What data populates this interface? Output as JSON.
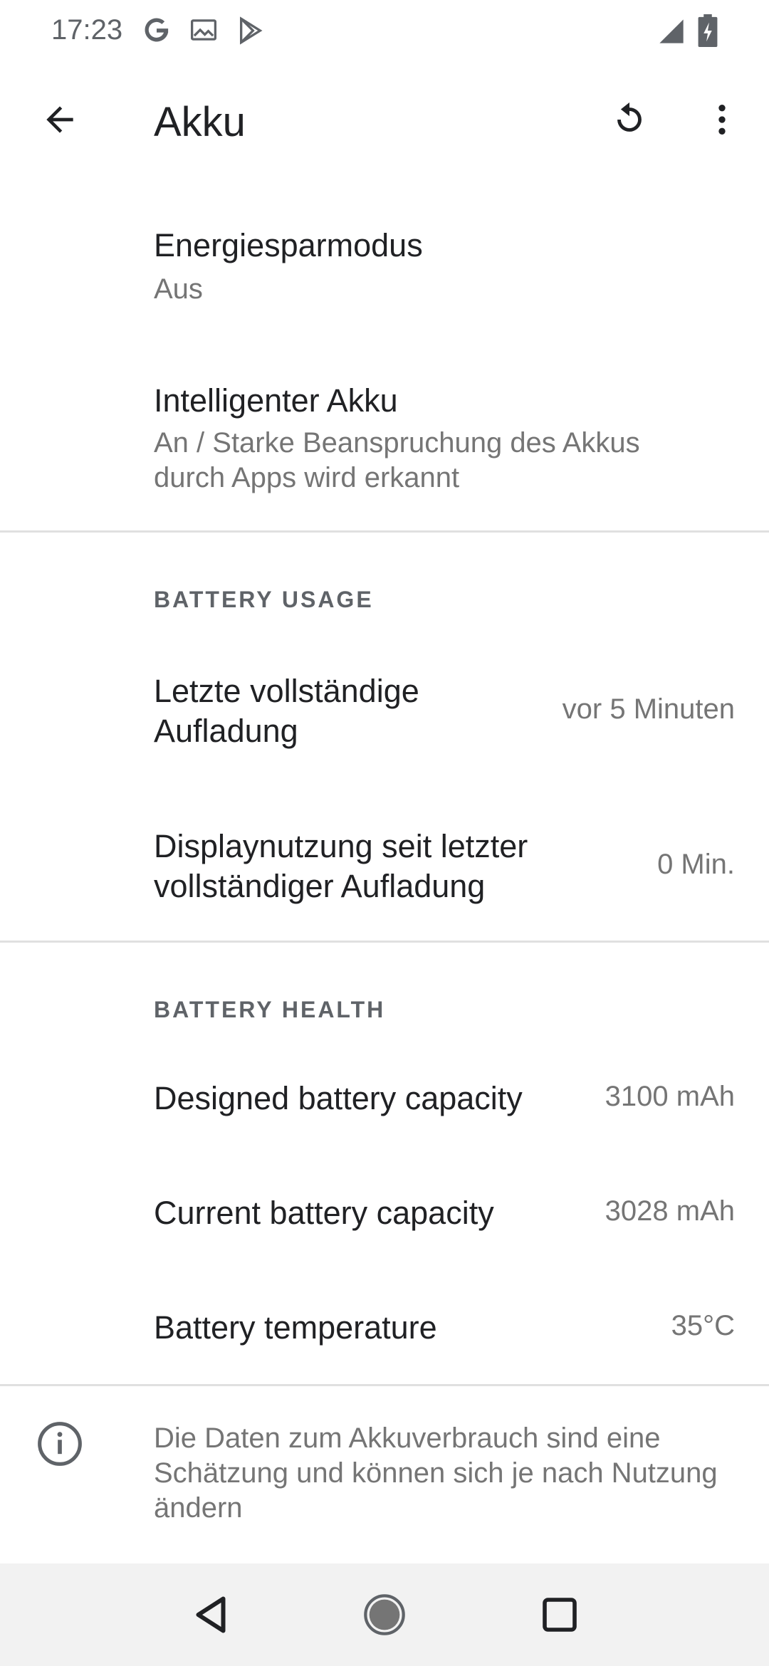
{
  "status_bar": {
    "time": "17:23",
    "left_icons": [
      "google-icon",
      "image-icon",
      "play-store-icon"
    ],
    "right_icons": [
      "signal-icon",
      "battery-charging-icon"
    ]
  },
  "app_bar": {
    "title": "Akku",
    "back_icon": "arrow-back-icon",
    "reset_icon": "reset-icon",
    "more_icon": "more-vert-icon"
  },
  "preferences": {
    "battery_saver": {
      "title": "Energiesparmodus",
      "summary": "Aus"
    },
    "adaptive_battery": {
      "title": "Intelligenter Akku",
      "summary": "An / Starke Beanspruchung des Akkus durch Apps wird erkannt"
    }
  },
  "battery_usage": {
    "header": "BATTERY USAGE",
    "last_full_charge": {
      "title_line1": "Letzte vollständige",
      "title_line2": "Aufladung",
      "value": "vor 5 Minuten"
    },
    "screen_usage": {
      "title_line1": "Displaynutzung seit letzter",
      "title_line2": "vollständiger Aufladung",
      "value": "0 Min."
    }
  },
  "battery_health": {
    "header": "BATTERY HEALTH",
    "designed_capacity": {
      "title": "Designed battery capacity",
      "value": "3100 mAh"
    },
    "current_capacity": {
      "title": "Current battery capacity",
      "value": "3028 mAh"
    },
    "temperature": {
      "title": "Battery temperature",
      "value": "35°C"
    }
  },
  "footer": {
    "icon": "info-icon",
    "text": "Die Daten zum Akkuverbrauch sind eine Schätzung und können sich je nach Nutzung ändern"
  },
  "nav_bar": {
    "back": "nav-back-icon",
    "home": "nav-home-icon",
    "recents": "nav-recents-icon"
  },
  "colors": {
    "text_primary": "#202124",
    "text_secondary": "#757575",
    "divider": "#e0e0e0",
    "nav_background": "#f2f2f2"
  }
}
